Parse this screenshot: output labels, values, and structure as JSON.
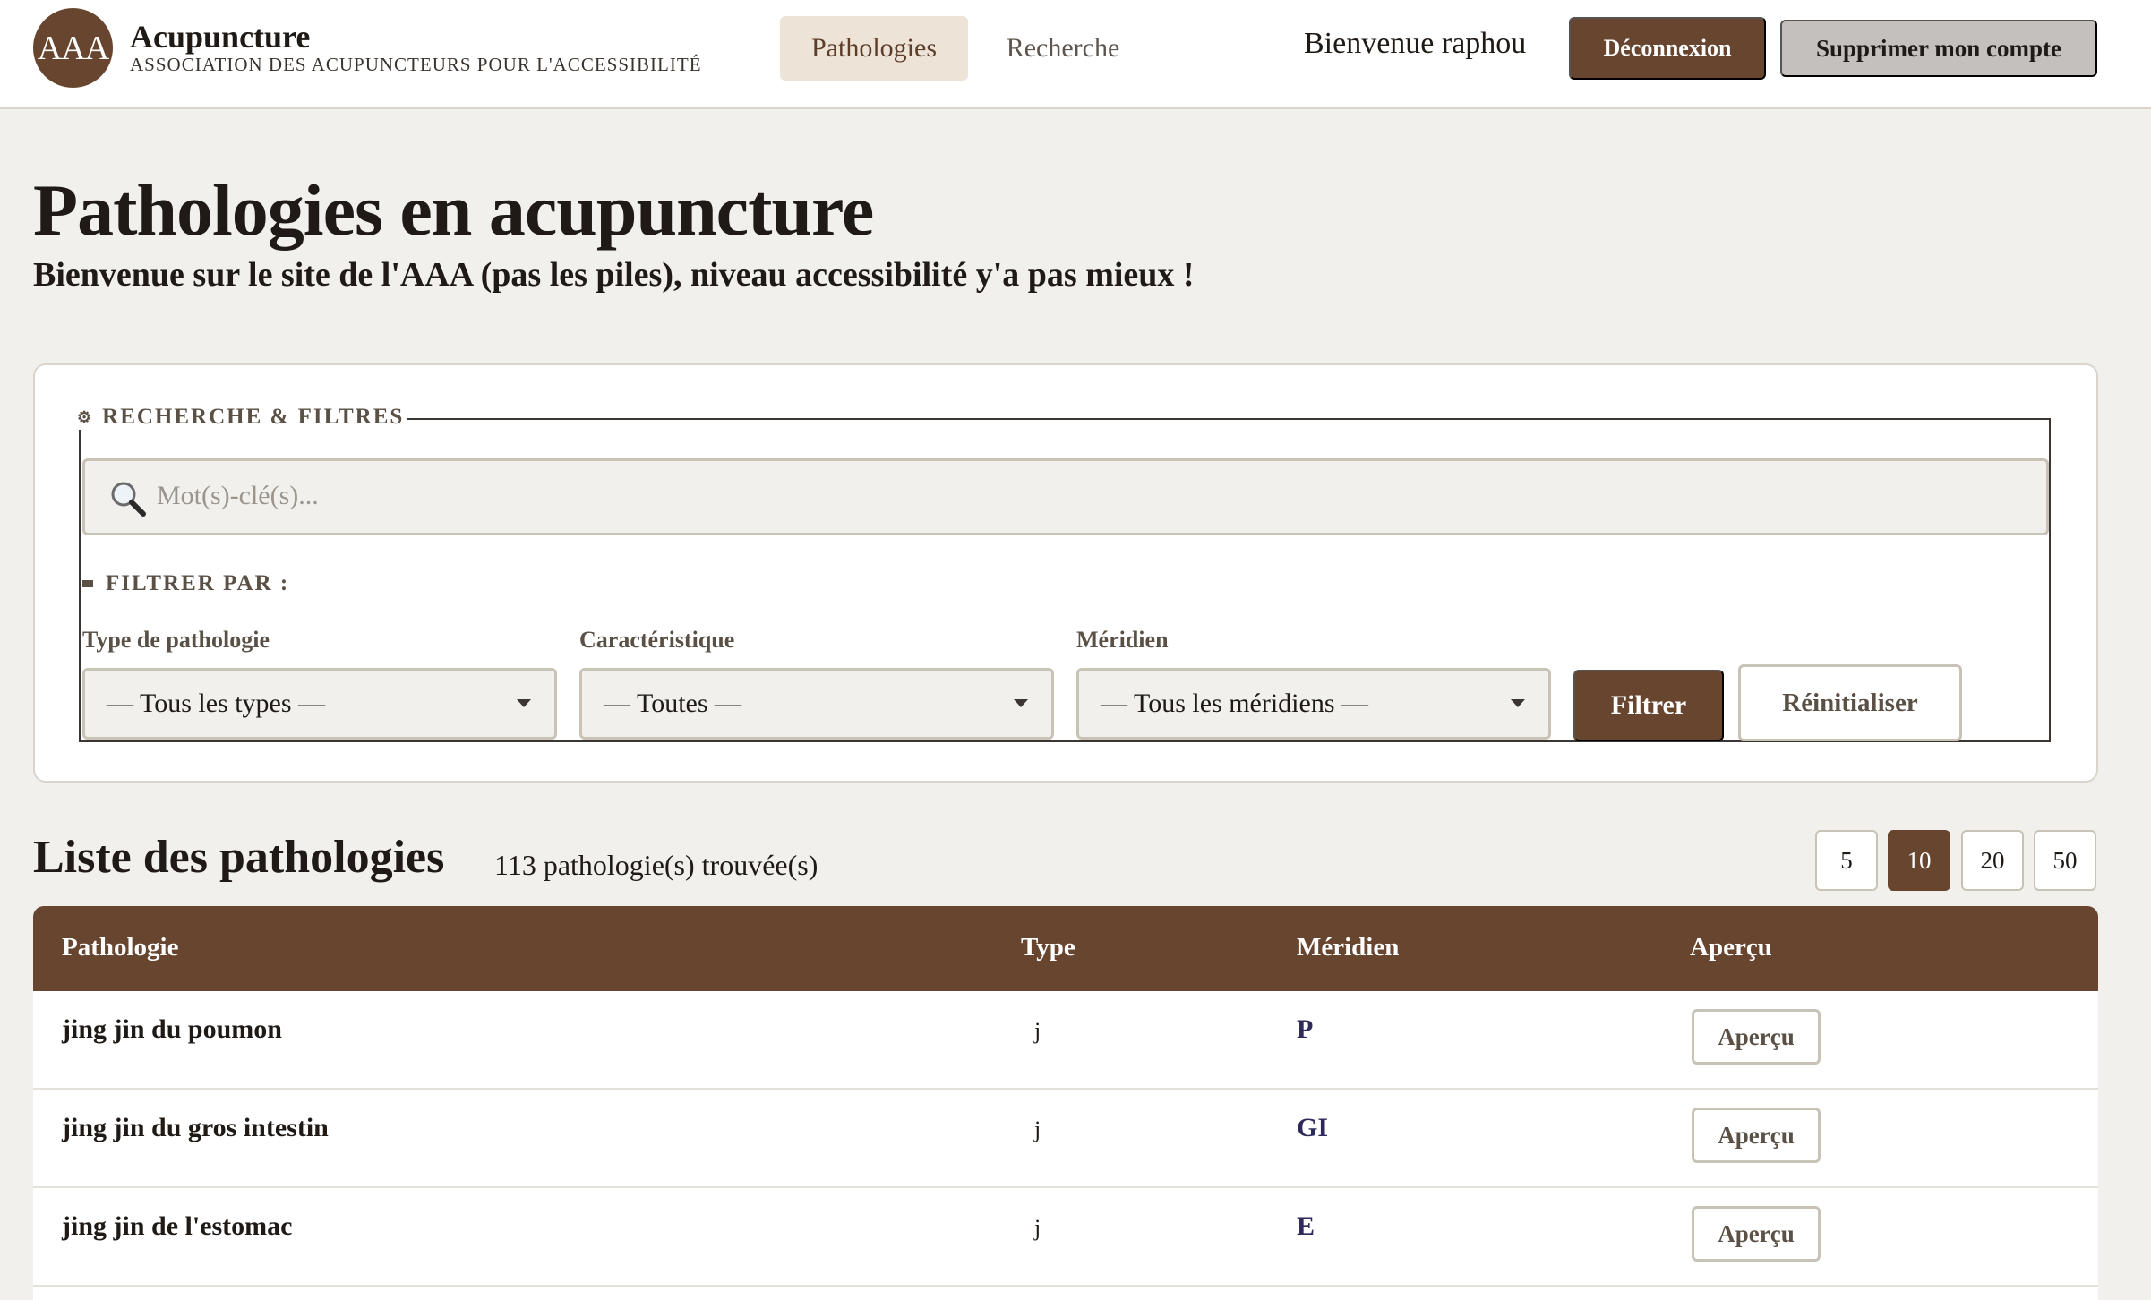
{
  "header": {
    "logo_text": "AAA",
    "brand_title": "Acupuncture",
    "brand_subtitle": "ASSOCIATION DES ACUPUNCTEURS POUR L'ACCESSIBILITÉ",
    "nav": [
      {
        "label": "Pathologies",
        "active": true
      },
      {
        "label": "Recherche",
        "active": false
      }
    ],
    "welcome": "Bienvenue raphou",
    "logout_label": "Déconnexion",
    "delete_account_label": "Supprimer mon compte"
  },
  "hero": {
    "title": "Pathologies en acupuncture",
    "subtitle": "Bienvenue sur le site de l'AAA (pas les piles), niveau accessibilité y'a pas mieux !"
  },
  "filters": {
    "legend": "RECHERCHE & FILTRES",
    "search_placeholder": "Mot(s)-clé(s)...",
    "filter_by": "FILTRER PAR :",
    "type": {
      "label": "Type de pathologie",
      "value": "— Tous les types —"
    },
    "caracteristique": {
      "label": "Caractéristique",
      "value": "— Toutes —"
    },
    "meridien": {
      "label": "Méridien",
      "value": "— Tous les méridiens —"
    },
    "filter_button": "Filtrer",
    "reset_button": "Réinitialiser"
  },
  "list": {
    "title": "Liste des pathologies",
    "count_text": "113 pathologie(s) trouvée(s)",
    "page_sizes": [
      "5",
      "10",
      "20",
      "50"
    ],
    "active_page_size": "10",
    "columns": [
      "Pathologie",
      "Type",
      "Méridien",
      "Aperçu"
    ],
    "rows": [
      {
        "name": "jing jin du poumon",
        "type": "j",
        "meridien": "P",
        "action": "Aperçu"
      },
      {
        "name": "jing jin du gros intestin",
        "type": "j",
        "meridien": "GI",
        "action": "Aperçu"
      },
      {
        "name": "jing jin de l'estomac",
        "type": "j",
        "meridien": "E",
        "action": "Aperçu"
      }
    ]
  },
  "colors": {
    "brand_brown": "#67452f",
    "background": "#f2f0ec",
    "nav_active_bg": "#ede3d6",
    "meridien_text": "#2e2a5b"
  }
}
